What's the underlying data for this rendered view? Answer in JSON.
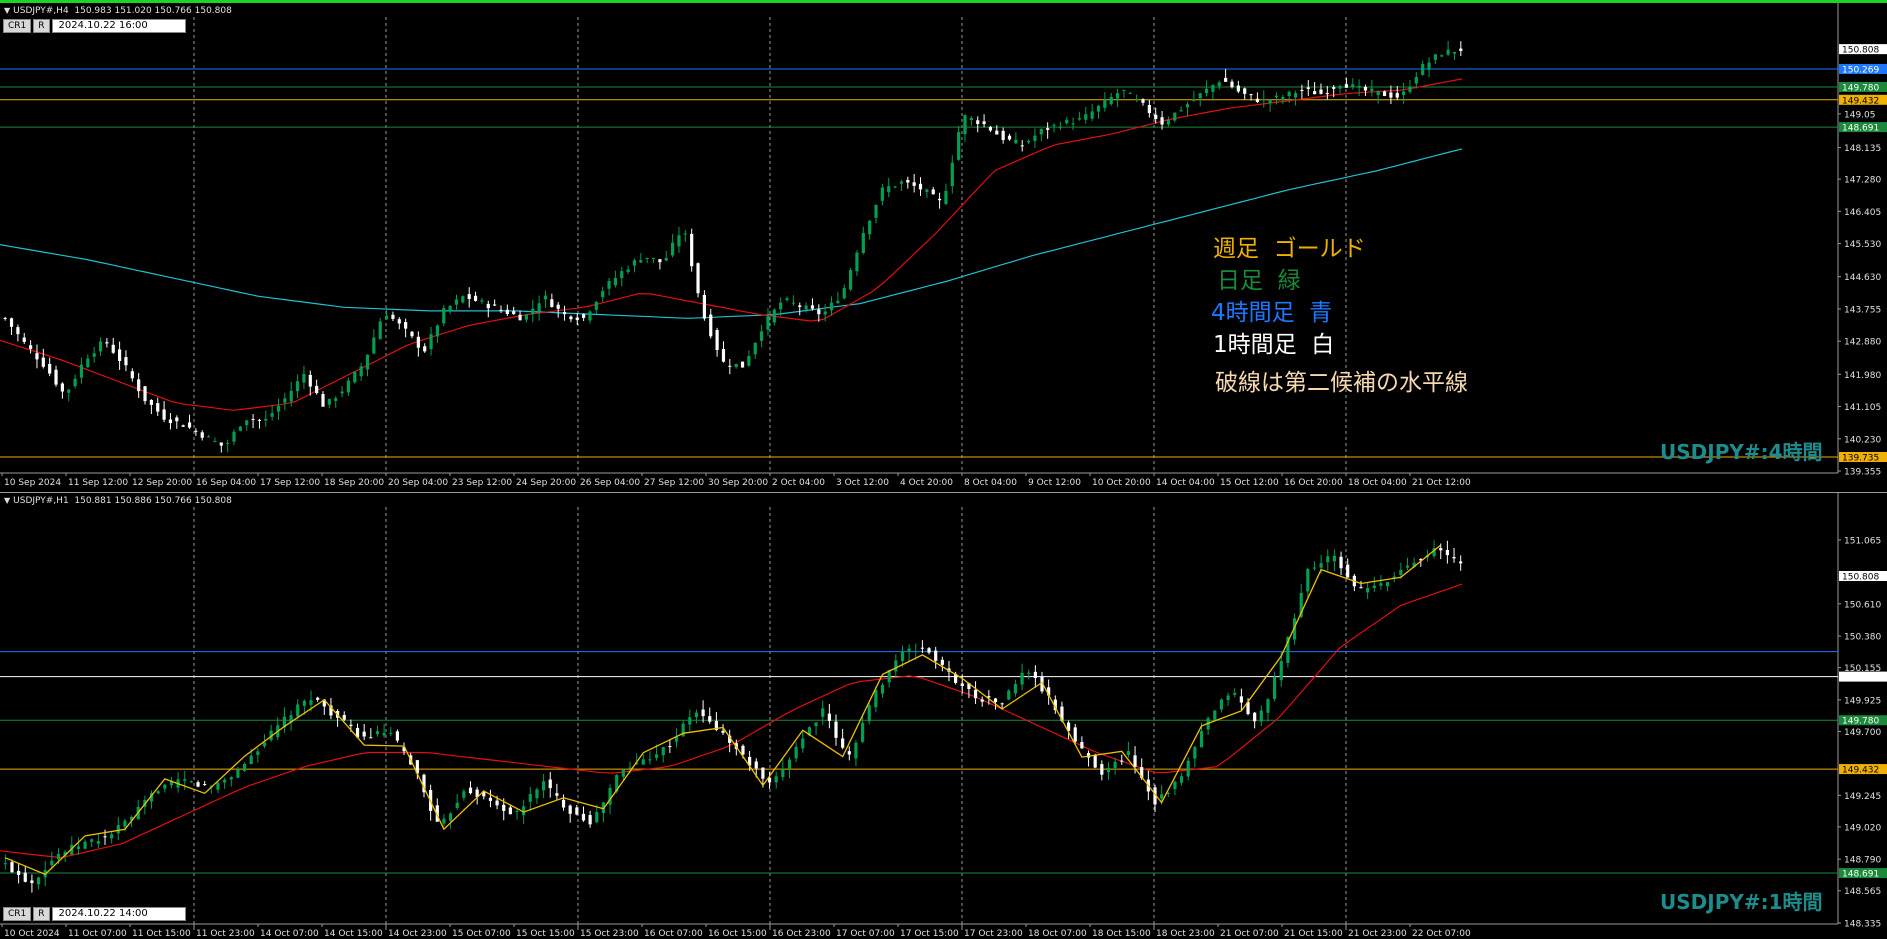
{
  "colors": {
    "bull": "#00a050",
    "bear": "#ffffff",
    "ma_red": "#e01010",
    "ma_cyan": "#20c0d0",
    "weekly_gold": "#f0b000",
    "daily_green": "#1a8a3a",
    "h4_blue": "#1e78ff",
    "h1_white": "#ffffff",
    "zigzag": "#f0c000",
    "grid": "#9a9a9a"
  },
  "h4": {
    "symbol_line": "USDJPY#,H4  150.983 151.020 150.766 150.808",
    "btn_cr": "CR1",
    "btn_r": "R",
    "timestamp": "2024.10.22 16:00",
    "watermark": "USDJPY#:4時間",
    "legend": {
      "weekly": "週足  ゴールド",
      "daily": "日足  緑",
      "h4": "4時間足  青",
      "h1": "1時間足  白",
      "dashed": "破線は第二候補の水平線"
    },
    "yticks": [
      "150.808",
      "150.269",
      "149.780",
      "149.432",
      "149.05",
      "148.691",
      "148.135",
      "147.280",
      "146.405",
      "145.530",
      "144.630",
      "143.755",
      "142.880",
      "141.980",
      "141.105",
      "140.230",
      "139.735",
      "139.355"
    ],
    "xticks": [
      "10 Sep 2024",
      "11 Sep 12:00",
      "12 Sep 20:00",
      "16 Sep 04:00",
      "17 Sep 12:00",
      "18 Sep 20:00",
      "20 Sep 04:00",
      "23 Sep 12:00",
      "24 Sep 20:00",
      "26 Sep 04:00",
      "27 Sep 12:00",
      "30 Sep 20:00",
      "2 Oct 04:00",
      "3 Oct 12:00",
      "4 Oct 20:00",
      "8 Oct 04:00",
      "9 Oct 12:00",
      "10 Oct 20:00",
      "14 Oct 04:00",
      "15 Oct 12:00",
      "16 Oct 20:00",
      "18 Oct 04:00",
      "21 Oct 12:00"
    ],
    "chart_data": {
      "type": "candlestick",
      "title": "USDJPY#,H4",
      "ylim": [
        139.355,
        151.3
      ],
      "close_path_estimate": [
        143.5,
        142.8,
        142.2,
        141.4,
        142.4,
        142.9,
        142.2,
        141.3,
        140.8,
        140.6,
        140.3,
        140.0,
        140.8,
        140.7,
        141.3,
        142.0,
        141.1,
        141.6,
        142.3,
        143.7,
        143.2,
        142.6,
        143.7,
        144.1,
        143.9,
        143.7,
        143.5,
        144.1,
        143.6,
        143.5,
        144.3,
        144.8,
        145.2,
        145.0,
        146.0,
        143.6,
        142.3,
        142.2,
        143.3,
        144.0,
        143.8,
        143.6,
        144.2,
        145.8,
        147.0,
        147.2,
        147.0,
        146.6,
        149.0,
        148.8,
        148.4,
        148.2,
        148.6,
        148.8,
        148.9,
        149.3,
        149.7,
        149.3,
        148.8,
        149.2,
        149.6,
        150.0,
        149.6,
        149.4,
        149.5,
        149.7,
        149.6,
        149.9,
        149.7,
        149.6,
        149.5,
        150.3,
        150.7,
        150.8
      ],
      "ma_red_estimate": [
        142.9,
        142.4,
        141.8,
        141.2,
        141.0,
        141.2,
        142.0,
        142.8,
        143.3,
        143.6,
        143.8,
        144.2,
        143.9,
        143.6,
        143.4,
        144.3,
        145.8,
        147.5,
        148.2,
        148.5,
        148.9,
        149.2,
        149.4,
        149.6,
        149.7,
        150.0
      ],
      "ma_cyan_estimate": [
        145.5,
        145.1,
        144.6,
        144.1,
        143.8,
        143.7,
        143.7,
        143.6,
        143.5,
        143.6,
        143.9,
        144.5,
        145.2,
        145.8,
        146.4,
        147.0,
        147.5,
        148.1
      ],
      "levels": [
        {
          "price": 150.269,
          "color": "#1e78ff",
          "label": "150.269"
        },
        {
          "price": 149.78,
          "color": "#1a8a3a",
          "label": "149.780"
        },
        {
          "price": 149.432,
          "color": "#f0b000",
          "label": "149.432"
        },
        {
          "price": 148.691,
          "color": "#1a8a3a",
          "label": "148.691"
        },
        {
          "price": 139.735,
          "color": "#f0b000",
          "label": "139.735"
        }
      ],
      "last_price": "150.808"
    }
  },
  "h1": {
    "symbol_line": "USDJPY#,H1  150.881 150.886 150.766 150.808",
    "btn_cr": "CR1",
    "btn_r": "R",
    "timestamp": "2024.10.22 14:00",
    "watermark": "USDJPY#:1時間",
    "yticks": [
      "151.065",
      "150.808",
      "150.610",
      "150.380",
      "150.155",
      "150.091",
      "149.925",
      "149.780",
      "149.700",
      "149.432",
      "149.245",
      "149.020",
      "148.790",
      "148.691",
      "148.565",
      "148.335"
    ],
    "xticks": [
      "10 Oct 2024",
      "11 Oct 07:00",
      "11 Oct 15:00",
      "11 Oct 23:00",
      "14 Oct 07:00",
      "14 Oct 15:00",
      "14 Oct 23:00",
      "15 Oct 07:00",
      "15 Oct 15:00",
      "15 Oct 23:00",
      "16 Oct 07:00",
      "16 Oct 15:00",
      "16 Oct 23:00",
      "17 Oct 07:00",
      "17 Oct 15:00",
      "17 Oct 23:00",
      "18 Oct 07:00",
      "18 Oct 15:00",
      "18 Oct 23:00",
      "21 Oct 07:00",
      "21 Oct 15:00",
      "21 Oct 23:00",
      "22 Oct 07:00"
    ],
    "chart_data": {
      "type": "candlestick",
      "title": "USDJPY#,H1",
      "ylim": [
        148.335,
        151.2
      ],
      "close_path_estimate": [
        148.75,
        148.62,
        148.82,
        148.9,
        148.95,
        149.1,
        149.3,
        149.35,
        149.3,
        149.4,
        149.6,
        149.8,
        149.95,
        149.8,
        149.65,
        149.7,
        149.45,
        149.0,
        149.3,
        149.2,
        149.1,
        149.35,
        149.15,
        149.05,
        149.4,
        149.5,
        149.6,
        149.85,
        149.7,
        149.5,
        149.3,
        149.6,
        149.85,
        149.5,
        149.95,
        150.25,
        150.3,
        150.1,
        149.95,
        149.9,
        150.15,
        149.9,
        149.6,
        149.4,
        149.55,
        149.2,
        149.35,
        149.75,
        150.0,
        149.75,
        150.2,
        150.85,
        150.95,
        150.7,
        150.75,
        150.9,
        151.0,
        150.9
      ],
      "ma_red_estimate": [
        148.85,
        148.8,
        148.9,
        149.1,
        149.3,
        149.45,
        149.55,
        149.55,
        149.5,
        149.45,
        149.4,
        149.45,
        149.6,
        149.85,
        150.05,
        150.1,
        149.95,
        149.75,
        149.55,
        149.4,
        149.45,
        149.8,
        150.3,
        150.6,
        150.75
      ],
      "levels": [
        {
          "price": 150.269,
          "color": "#1e78ff",
          "label": "150.269"
        },
        {
          "price": 150.091,
          "color": "#ffffff",
          "label": "150.091"
        },
        {
          "price": 149.78,
          "color": "#1a8a3a",
          "label": "149.780"
        },
        {
          "price": 149.432,
          "color": "#f0b000",
          "label": "149.432"
        },
        {
          "price": 148.691,
          "color": "#1a8a3a",
          "label": "148.691"
        }
      ],
      "last_price": "150.808"
    }
  }
}
